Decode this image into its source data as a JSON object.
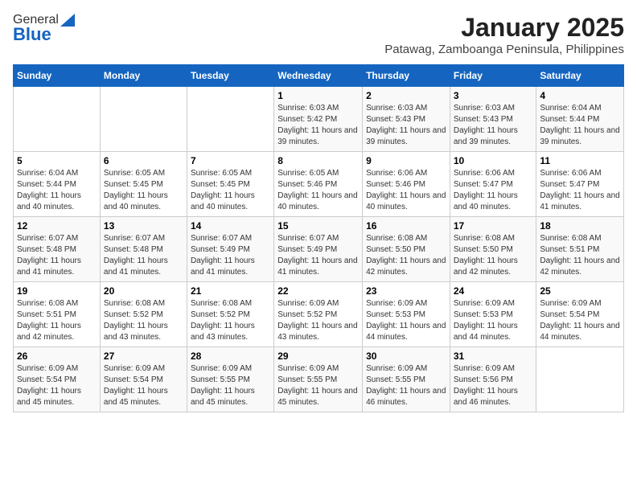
{
  "header": {
    "logo_general": "General",
    "logo_blue": "Blue",
    "title": "January 2025",
    "subtitle": "Patawag, Zamboanga Peninsula, Philippines"
  },
  "weekdays": [
    "Sunday",
    "Monday",
    "Tuesday",
    "Wednesday",
    "Thursday",
    "Friday",
    "Saturday"
  ],
  "weeks": [
    [
      {
        "day": "",
        "info": ""
      },
      {
        "day": "",
        "info": ""
      },
      {
        "day": "",
        "info": ""
      },
      {
        "day": "1",
        "info": "Sunrise: 6:03 AM\nSunset: 5:42 PM\nDaylight: 11 hours and 39 minutes."
      },
      {
        "day": "2",
        "info": "Sunrise: 6:03 AM\nSunset: 5:43 PM\nDaylight: 11 hours and 39 minutes."
      },
      {
        "day": "3",
        "info": "Sunrise: 6:03 AM\nSunset: 5:43 PM\nDaylight: 11 hours and 39 minutes."
      },
      {
        "day": "4",
        "info": "Sunrise: 6:04 AM\nSunset: 5:44 PM\nDaylight: 11 hours and 39 minutes."
      }
    ],
    [
      {
        "day": "5",
        "info": "Sunrise: 6:04 AM\nSunset: 5:44 PM\nDaylight: 11 hours and 40 minutes."
      },
      {
        "day": "6",
        "info": "Sunrise: 6:05 AM\nSunset: 5:45 PM\nDaylight: 11 hours and 40 minutes."
      },
      {
        "day": "7",
        "info": "Sunrise: 6:05 AM\nSunset: 5:45 PM\nDaylight: 11 hours and 40 minutes."
      },
      {
        "day": "8",
        "info": "Sunrise: 6:05 AM\nSunset: 5:46 PM\nDaylight: 11 hours and 40 minutes."
      },
      {
        "day": "9",
        "info": "Sunrise: 6:06 AM\nSunset: 5:46 PM\nDaylight: 11 hours and 40 minutes."
      },
      {
        "day": "10",
        "info": "Sunrise: 6:06 AM\nSunset: 5:47 PM\nDaylight: 11 hours and 40 minutes."
      },
      {
        "day": "11",
        "info": "Sunrise: 6:06 AM\nSunset: 5:47 PM\nDaylight: 11 hours and 41 minutes."
      }
    ],
    [
      {
        "day": "12",
        "info": "Sunrise: 6:07 AM\nSunset: 5:48 PM\nDaylight: 11 hours and 41 minutes."
      },
      {
        "day": "13",
        "info": "Sunrise: 6:07 AM\nSunset: 5:48 PM\nDaylight: 11 hours and 41 minutes."
      },
      {
        "day": "14",
        "info": "Sunrise: 6:07 AM\nSunset: 5:49 PM\nDaylight: 11 hours and 41 minutes."
      },
      {
        "day": "15",
        "info": "Sunrise: 6:07 AM\nSunset: 5:49 PM\nDaylight: 11 hours and 41 minutes."
      },
      {
        "day": "16",
        "info": "Sunrise: 6:08 AM\nSunset: 5:50 PM\nDaylight: 11 hours and 42 minutes."
      },
      {
        "day": "17",
        "info": "Sunrise: 6:08 AM\nSunset: 5:50 PM\nDaylight: 11 hours and 42 minutes."
      },
      {
        "day": "18",
        "info": "Sunrise: 6:08 AM\nSunset: 5:51 PM\nDaylight: 11 hours and 42 minutes."
      }
    ],
    [
      {
        "day": "19",
        "info": "Sunrise: 6:08 AM\nSunset: 5:51 PM\nDaylight: 11 hours and 42 minutes."
      },
      {
        "day": "20",
        "info": "Sunrise: 6:08 AM\nSunset: 5:52 PM\nDaylight: 11 hours and 43 minutes."
      },
      {
        "day": "21",
        "info": "Sunrise: 6:08 AM\nSunset: 5:52 PM\nDaylight: 11 hours and 43 minutes."
      },
      {
        "day": "22",
        "info": "Sunrise: 6:09 AM\nSunset: 5:52 PM\nDaylight: 11 hours and 43 minutes."
      },
      {
        "day": "23",
        "info": "Sunrise: 6:09 AM\nSunset: 5:53 PM\nDaylight: 11 hours and 44 minutes."
      },
      {
        "day": "24",
        "info": "Sunrise: 6:09 AM\nSunset: 5:53 PM\nDaylight: 11 hours and 44 minutes."
      },
      {
        "day": "25",
        "info": "Sunrise: 6:09 AM\nSunset: 5:54 PM\nDaylight: 11 hours and 44 minutes."
      }
    ],
    [
      {
        "day": "26",
        "info": "Sunrise: 6:09 AM\nSunset: 5:54 PM\nDaylight: 11 hours and 45 minutes."
      },
      {
        "day": "27",
        "info": "Sunrise: 6:09 AM\nSunset: 5:54 PM\nDaylight: 11 hours and 45 minutes."
      },
      {
        "day": "28",
        "info": "Sunrise: 6:09 AM\nSunset: 5:55 PM\nDaylight: 11 hours and 45 minutes."
      },
      {
        "day": "29",
        "info": "Sunrise: 6:09 AM\nSunset: 5:55 PM\nDaylight: 11 hours and 45 minutes."
      },
      {
        "day": "30",
        "info": "Sunrise: 6:09 AM\nSunset: 5:55 PM\nDaylight: 11 hours and 46 minutes."
      },
      {
        "day": "31",
        "info": "Sunrise: 6:09 AM\nSunset: 5:56 PM\nDaylight: 11 hours and 46 minutes."
      },
      {
        "day": "",
        "info": ""
      }
    ]
  ]
}
